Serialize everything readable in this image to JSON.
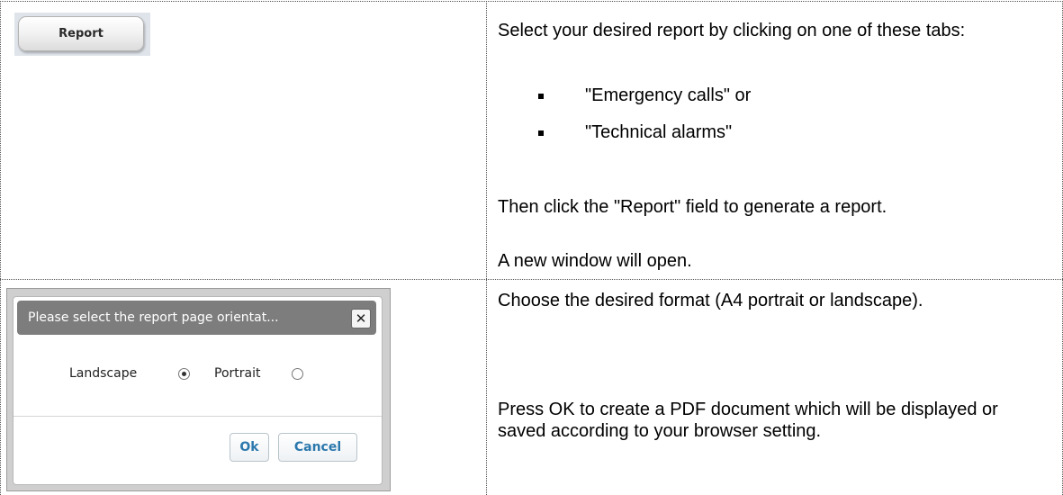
{
  "left_top": {
    "report_button": "Report"
  },
  "right_top": {
    "intro": "Select your desired report by clicking on one of these tabs:",
    "bullets": [
      "\"Emergency calls\" or",
      "\"Technical alarms\""
    ],
    "instruction": "Then click the \"Report\" field to generate a report.",
    "result": "A new window will open."
  },
  "dialog": {
    "title": "Please select the report page orientat...",
    "close_icon": "close-icon",
    "options": [
      {
        "label": "Landscape",
        "selected": true
      },
      {
        "label": "Portrait",
        "selected": false
      }
    ],
    "ok_label": "Ok",
    "cancel_label": "Cancel"
  },
  "right_bottom": {
    "format": "Choose the desired format (A4 portrait or landscape).",
    "pdf": "Press OK to create a PDF document which will be displayed or saved according to your browser setting."
  }
}
